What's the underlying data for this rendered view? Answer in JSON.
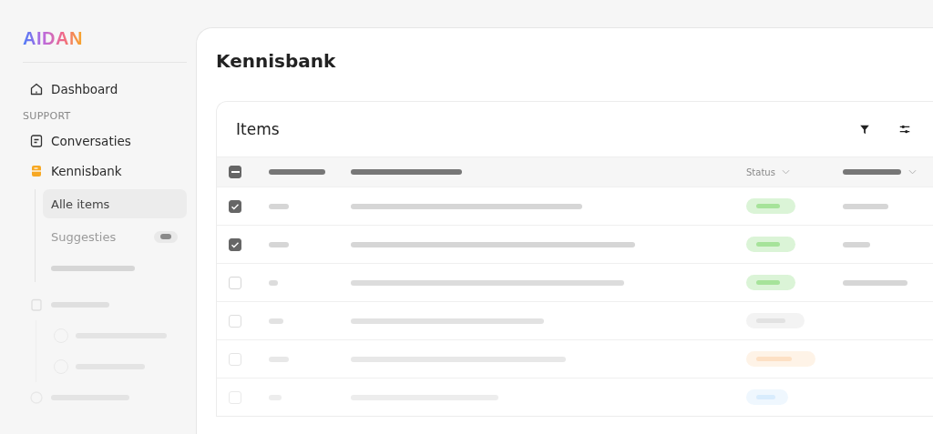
{
  "logo": "AIDAN",
  "sidebar": {
    "items": [
      {
        "label": "Dashboard",
        "selected": false
      }
    ],
    "section": "SUPPORT",
    "support_items": [
      {
        "label": "Conversaties",
        "selected": false
      },
      {
        "label": "Kennisbank",
        "selected": true,
        "children": [
          {
            "label": "Alle items",
            "selected": true,
            "badge": false
          },
          {
            "label": "Suggesties",
            "selected": false,
            "badge": true
          }
        ]
      }
    ]
  },
  "page": {
    "title": "Kennisbank"
  },
  "table": {
    "title": "Items",
    "select_all": {
      "indeterminate": true
    },
    "status_header": "Status",
    "rows": [
      {
        "checked": true,
        "color": "#a6e39a"
      },
      {
        "checked": true,
        "color": "#a6e39a"
      },
      {
        "checked": false,
        "color": "#a6e39a"
      },
      {
        "checked": false,
        "color": "#e2e2e2"
      },
      {
        "checked": false,
        "color": "#fde0c4"
      },
      {
        "checked": false,
        "color": "#d8ecfd"
      }
    ]
  }
}
